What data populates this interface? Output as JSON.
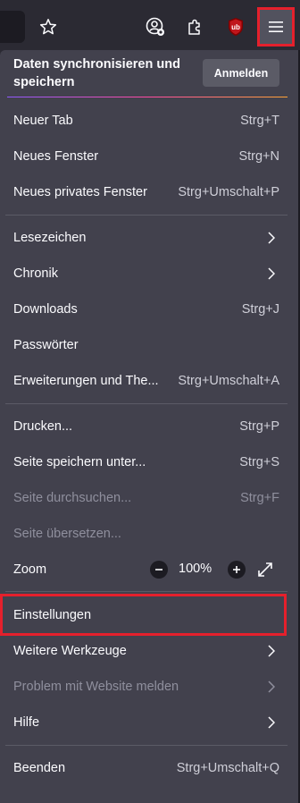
{
  "colors": {
    "toolbar_bg": "#2b2a33",
    "panel_bg": "#42414d",
    "highlight": "#e5202c",
    "disabled_text": "#8f8f9d"
  },
  "toolbar": {
    "buttons": [
      {
        "name": "bookmark-star",
        "icon": "star-icon"
      },
      {
        "name": "account",
        "icon": "account-icon"
      },
      {
        "name": "extensions",
        "icon": "puzzle-icon"
      },
      {
        "name": "ublock",
        "icon": "ublock-icon"
      },
      {
        "name": "app-menu",
        "icon": "hamburger-icon"
      }
    ]
  },
  "sync": {
    "title": "Daten synchronisieren und speichern",
    "button_label": "Anmelden"
  },
  "menu": {
    "new_tab": {
      "label": "Neuer Tab",
      "shortcut": "Strg+T"
    },
    "new_window": {
      "label": "Neues Fenster",
      "shortcut": "Strg+N"
    },
    "new_private": {
      "label": "Neues privates Fenster",
      "shortcut": "Strg+Umschalt+P"
    },
    "bookmarks": {
      "label": "Lesezeichen"
    },
    "history": {
      "label": "Chronik"
    },
    "downloads": {
      "label": "Downloads",
      "shortcut": "Strg+J"
    },
    "passwords": {
      "label": "Passwörter"
    },
    "addons": {
      "label": "Erweiterungen und The...",
      "shortcut": "Strg+Umschalt+A"
    },
    "print": {
      "label": "Drucken...",
      "shortcut": "Strg+P"
    },
    "save_page": {
      "label": "Seite speichern unter...",
      "shortcut": "Strg+S"
    },
    "find": {
      "label": "Seite durchsuchen...",
      "shortcut": "Strg+F",
      "disabled": true
    },
    "translate": {
      "label": "Seite übersetzen...",
      "disabled": true
    },
    "zoom": {
      "label": "Zoom",
      "value": "100%"
    },
    "settings": {
      "label": "Einstellungen"
    },
    "more_tools": {
      "label": "Weitere Werkzeuge"
    },
    "report_site": {
      "label": "Problem mit Website melden",
      "disabled": true
    },
    "help": {
      "label": "Hilfe"
    },
    "quit": {
      "label": "Beenden",
      "shortcut": "Strg+Umschalt+Q"
    }
  }
}
